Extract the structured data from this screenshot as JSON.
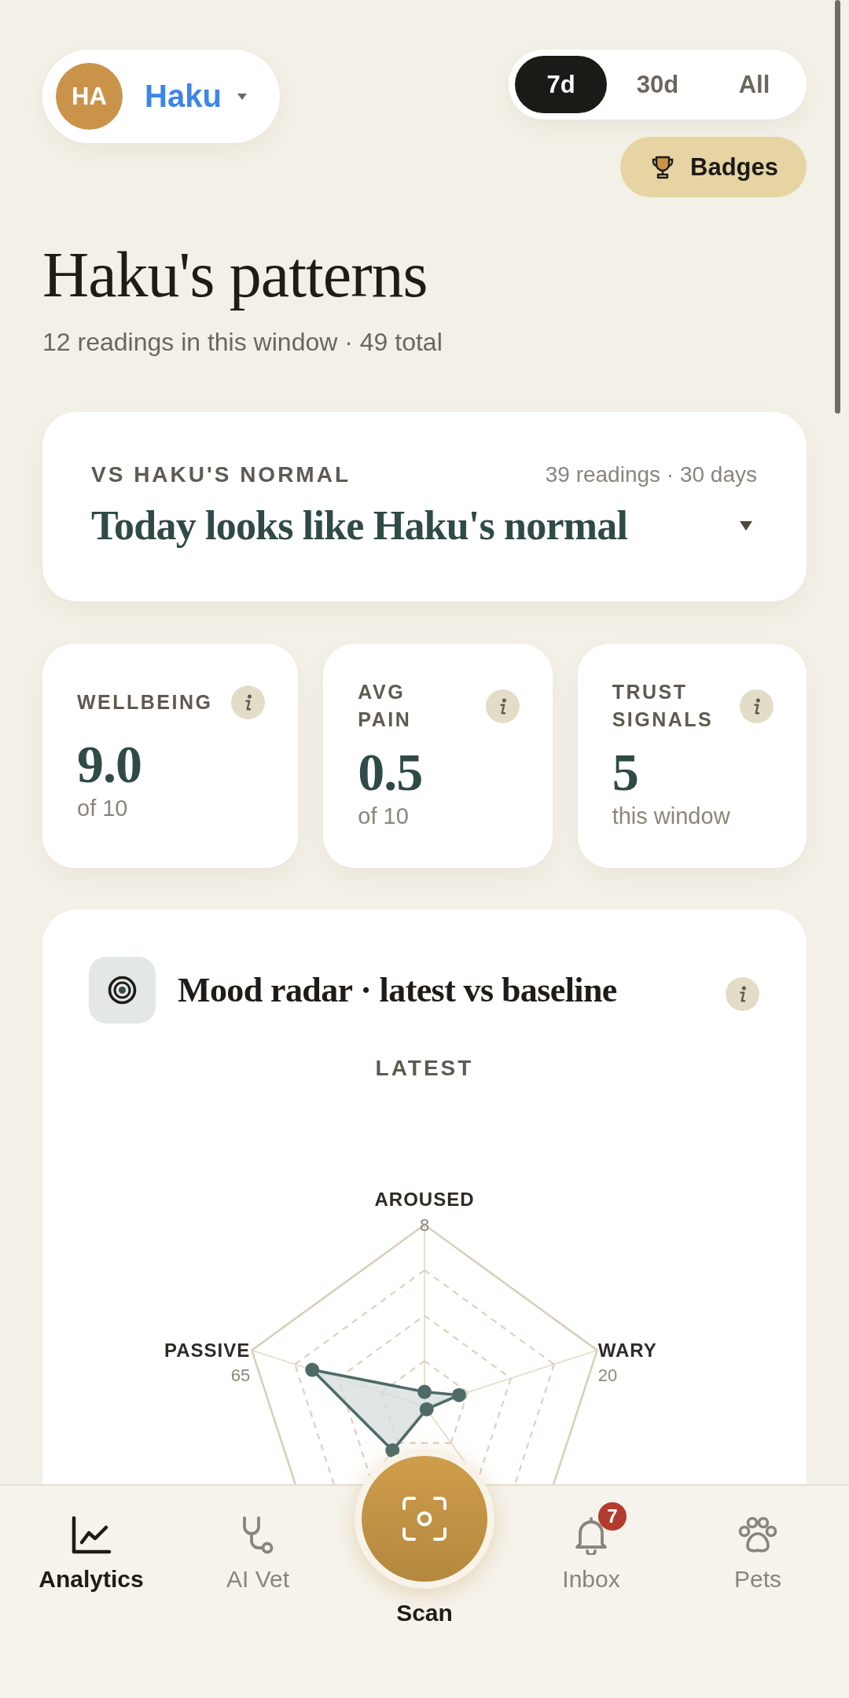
{
  "pet_picker": {
    "initials": "HA",
    "name": "Haku"
  },
  "range_tabs": [
    {
      "label": "7d",
      "selected": true
    },
    {
      "label": "30d",
      "selected": false
    },
    {
      "label": "All",
      "selected": false
    }
  ],
  "badges_button": {
    "label": "Badges"
  },
  "header": {
    "title": "Haku's patterns",
    "subtitle": "12 readings in this window · 49 total"
  },
  "baseline_card": {
    "label": "VS HAKU'S NORMAL",
    "meta": "39 readings · 30 days",
    "headline": "Today looks like Haku's normal",
    "expanded": false
  },
  "metrics": [
    {
      "label": "WELLBEING",
      "value": "9.0",
      "unit": "of 10"
    },
    {
      "label": "AVG PAIN",
      "value": "0.5",
      "unit": "of 10"
    },
    {
      "label": "TRUST SIGNALS",
      "value": "5",
      "unit": "this window"
    }
  ],
  "radar_card": {
    "title": "Mood radar · latest vs baseline",
    "mode": "LATEST",
    "axes": [
      {
        "label": "AROUSED",
        "reading": "8"
      },
      {
        "label": "PASSIVE",
        "reading": "65"
      },
      {
        "label": "WARY",
        "reading": "20"
      }
    ]
  },
  "nav": [
    {
      "kind": "tab",
      "label": "Analytics",
      "selected": true
    },
    {
      "kind": "tab",
      "label": "AI Vet",
      "selected": false
    },
    {
      "kind": "action",
      "label": "Scan"
    },
    {
      "kind": "tab",
      "label": "Inbox",
      "selected": false,
      "badge": "7"
    },
    {
      "kind": "tab",
      "label": "Pets",
      "selected": false
    }
  ]
}
